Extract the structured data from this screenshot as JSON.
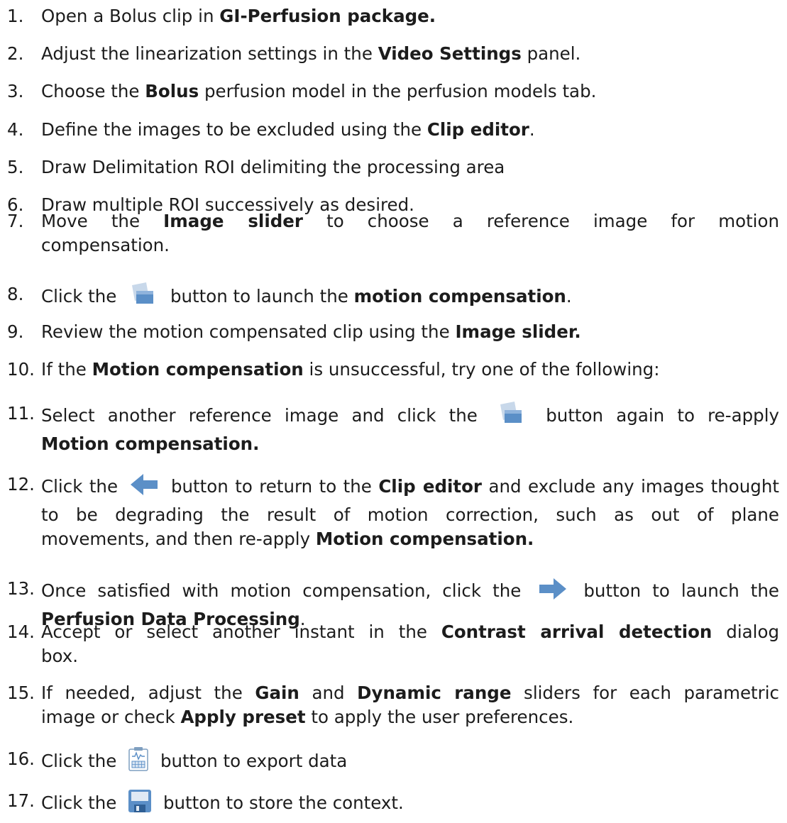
{
  "steps": [
    {
      "num": "1.",
      "p": [
        "Open a Bolus clip in ",
        "GI-Perfusion package."
      ]
    },
    {
      "num": "2.",
      "p": [
        "Adjust the linearization settings in the ",
        "Video Settings",
        " panel."
      ]
    },
    {
      "num": "3.",
      "p": [
        "Choose the ",
        "Bolus",
        " perfusion model in the perfusion models tab."
      ]
    },
    {
      "num": "4.",
      "p": [
        "Define the images to be excluded using the ",
        "Clip editor",
        "."
      ]
    },
    {
      "num": "5.",
      "p": [
        "Draw Delimitation ROI delimiting the processing area"
      ]
    },
    {
      "num": "6.",
      "p": [
        "Draw multiple ROI successively as desired."
      ]
    },
    {
      "num": "7.",
      "p": [
        "Move the ",
        "Image slider",
        " to choose a reference image for motion",
        "compensation."
      ]
    },
    {
      "num": "8.",
      "p": [
        "Click the ",
        " button to launch the ",
        "motion compensation",
        "."
      ]
    },
    {
      "num": "9.",
      "p": [
        "Review the motion compensated clip using the ",
        "Image slider."
      ]
    },
    {
      "num": "10.",
      "p": [
        "If the ",
        "Motion compensation",
        " is unsuccessful, try one of the following:"
      ]
    },
    {
      "num": "11.",
      "p": [
        "Select another reference image and click the ",
        " button again to re-apply",
        "Motion compensation."
      ]
    },
    {
      "num": "12.",
      "p": [
        "Click the ",
        " button to return to the ",
        "Clip editor",
        " and exclude any images",
        "thought to be degrading the result of motion correction, such as out of plane",
        "movements, and then re-apply ",
        "Motion compensation."
      ]
    },
    {
      "num": "13.",
      "p": [
        "Once satisfied with motion compensation, click the ",
        " button to launch the",
        "Perfusion Data Processing",
        "."
      ]
    },
    {
      "num": "14.",
      "p": [
        "Accept or select another instant in the ",
        "Contrast arrival detection",
        " dialog",
        "box."
      ]
    },
    {
      "num": "15.",
      "p": [
        "If needed, adjust the ",
        "Gain",
        " and ",
        "Dynamic range",
        " sliders for each parametric",
        "image or check ",
        "Apply preset",
        " to apply the user preferences."
      ]
    },
    {
      "num": "16.",
      "p": [
        "Click the ",
        " button to export data"
      ]
    },
    {
      "num": "17.",
      "p": [
        "Click the ",
        " button to store the context."
      ]
    }
  ],
  "icons": {
    "step8": "motion-compensation-icon",
    "step11": "motion-compensation-icon",
    "step12": "back-arrow-icon",
    "step13": "forward-arrow-icon",
    "step16": "export-data-icon",
    "step17": "save-context-icon"
  },
  "colors": {
    "icon_blue": "#5b8fc7",
    "icon_light": "#c8d8ea",
    "text": "#1c1c1c"
  }
}
